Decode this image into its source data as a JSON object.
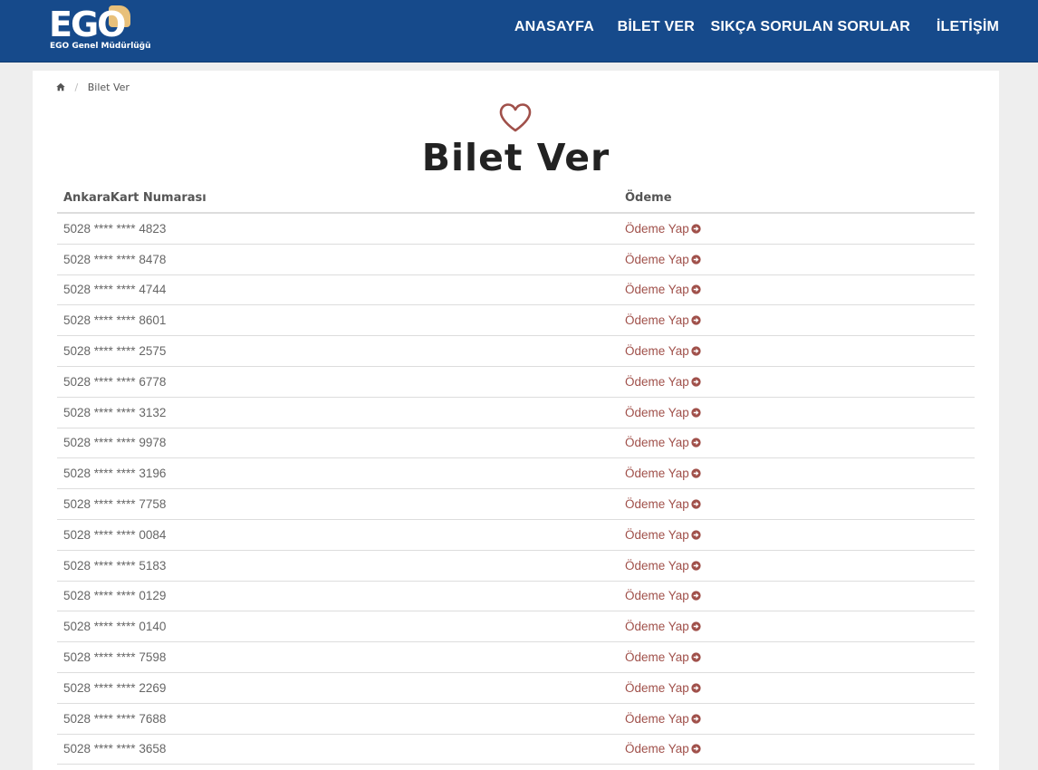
{
  "header": {
    "logo_text": "EGO",
    "logo_subtitle": "EGO Genel Müdürlüğü",
    "nav": [
      "ANASAYFA",
      "BİLET VER",
      "SIKÇA SORULAN SORULAR",
      "İLETİŞİM"
    ]
  },
  "breadcrumb": {
    "current": "Bilet Ver",
    "home_icon": "home-icon"
  },
  "page": {
    "icon": "heart-icon",
    "title": "Bilet Ver"
  },
  "table": {
    "headers": [
      "AnkaraKart Numarası",
      "Ödeme"
    ],
    "rows": [
      {
        "card": "5028 **** **** 4823",
        "action": "Ödeme Yap"
      },
      {
        "card": "5028 **** **** 8478",
        "action": "Ödeme Yap"
      },
      {
        "card": "5028 **** **** 4744",
        "action": "Ödeme Yap"
      },
      {
        "card": "5028 **** **** 8601",
        "action": "Ödeme Yap"
      },
      {
        "card": "5028 **** **** 2575",
        "action": "Ödeme Yap"
      },
      {
        "card": "5028 **** **** 6778",
        "action": "Ödeme Yap"
      },
      {
        "card": "5028 **** **** 3132",
        "action": "Ödeme Yap"
      },
      {
        "card": "5028 **** **** 9978",
        "action": "Ödeme Yap"
      },
      {
        "card": "5028 **** **** 3196",
        "action": "Ödeme Yap"
      },
      {
        "card": "5028 **** **** 7758",
        "action": "Ödeme Yap"
      },
      {
        "card": "5028 **** **** 0084",
        "action": "Ödeme Yap"
      },
      {
        "card": "5028 **** **** 5183",
        "action": "Ödeme Yap"
      },
      {
        "card": "5028 **** **** 0129",
        "action": "Ödeme Yap"
      },
      {
        "card": "5028 **** **** 0140",
        "action": "Ödeme Yap"
      },
      {
        "card": "5028 **** **** 7598",
        "action": "Ödeme Yap"
      },
      {
        "card": "5028 **** **** 2269",
        "action": "Ödeme Yap"
      },
      {
        "card": "5028 **** **** 7688",
        "action": "Ödeme Yap"
      },
      {
        "card": "5028 **** **** 3658",
        "action": "Ödeme Yap"
      }
    ]
  },
  "colors": {
    "header_bg": "#164a8b",
    "link": "#a0504a",
    "accent": "#e8c07a"
  }
}
